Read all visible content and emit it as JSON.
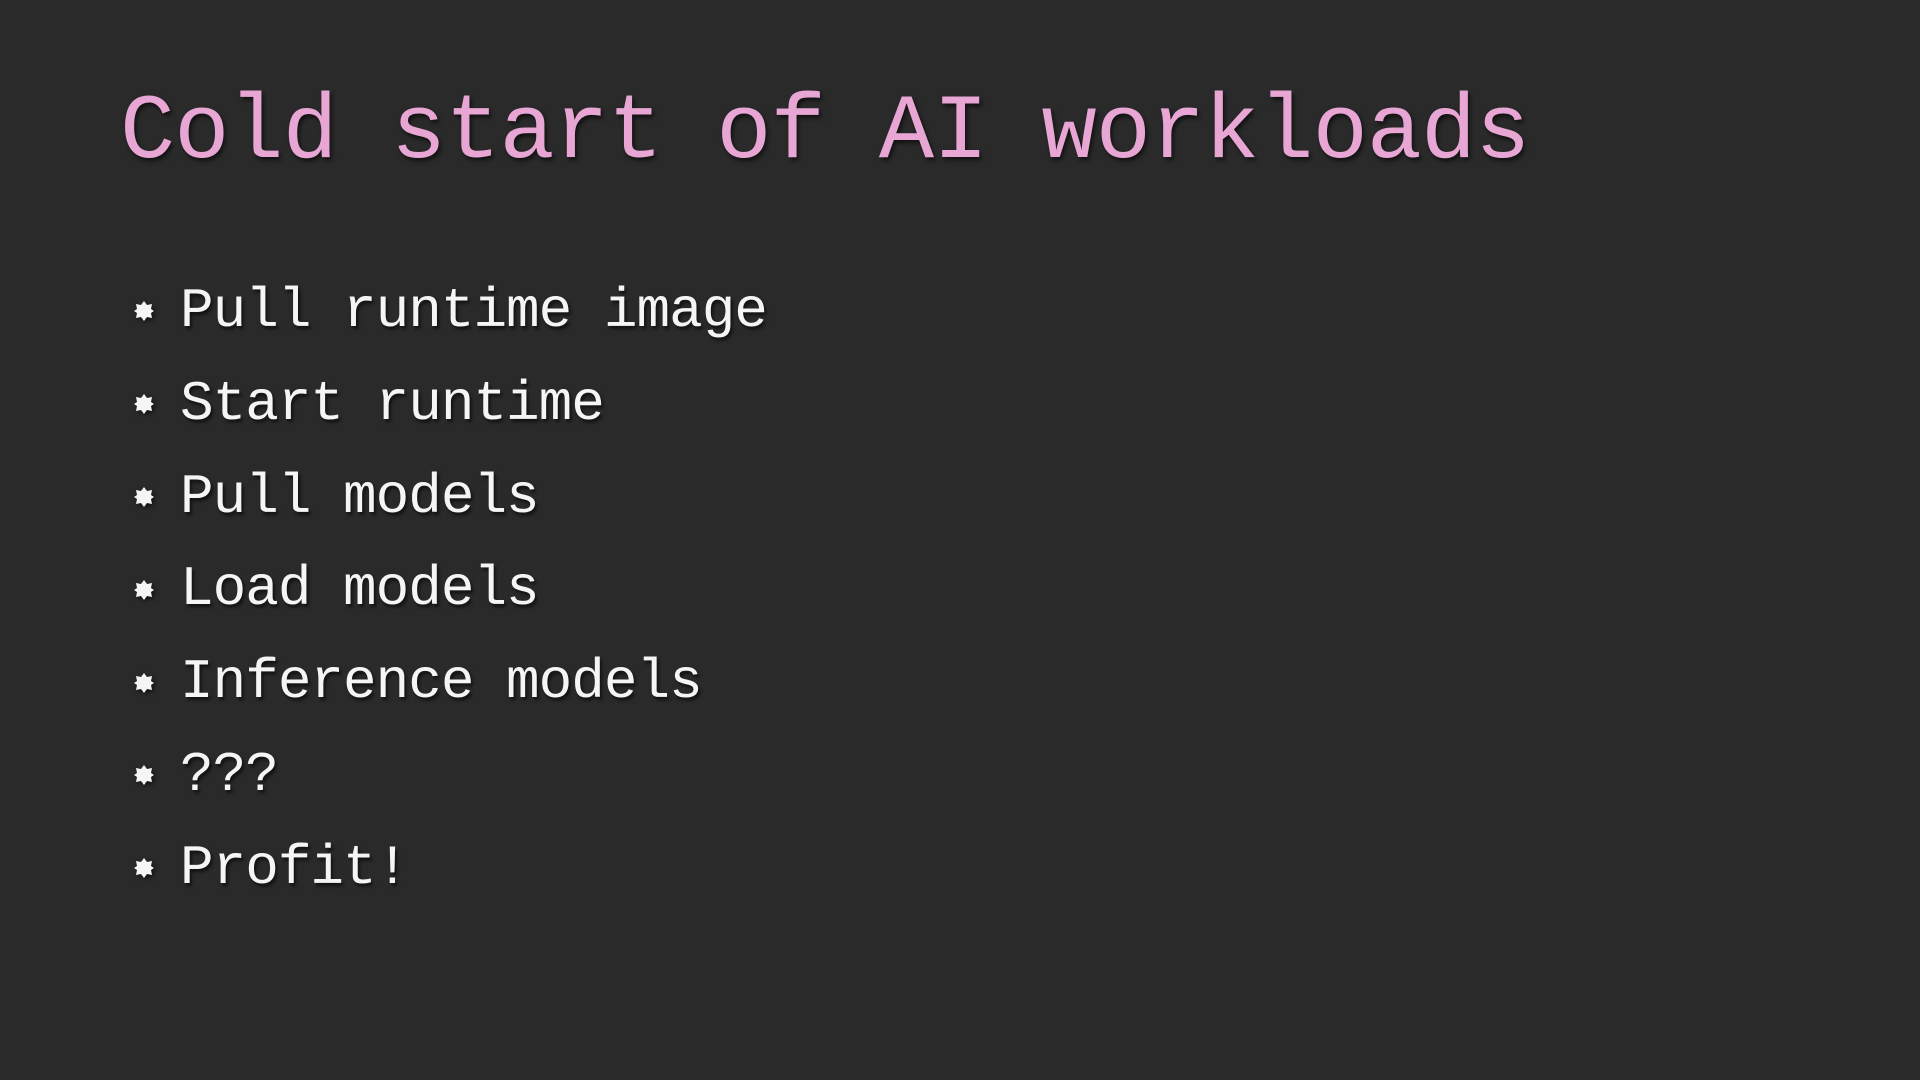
{
  "slide": {
    "title": "Cold start of AI workloads",
    "bullets": [
      "Pull runtime image",
      "Start runtime",
      "Pull models",
      "Load models",
      "Inference models",
      "???",
      "Profit!"
    ]
  },
  "colors": {
    "background": "#2a2a2a",
    "title": "#e8a6d4",
    "text": "#f5f5f5"
  }
}
